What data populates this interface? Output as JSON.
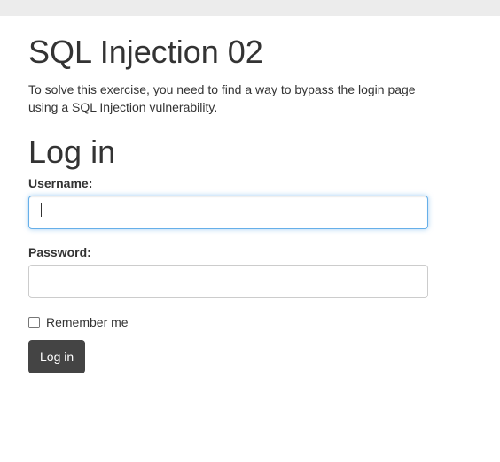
{
  "page": {
    "title": "SQL Injection 02",
    "description": "To solve this exercise, you need to find a way to bypass the login page using a SQL Injection vulnerability."
  },
  "login_form": {
    "heading": "Log in",
    "username": {
      "label": "Username:",
      "value": "",
      "focused": true
    },
    "password": {
      "label": "Password:",
      "value": ""
    },
    "remember_me": {
      "label": "Remember me",
      "checked": false
    },
    "submit_label": "Log in"
  },
  "colors": {
    "top_bar": "#ececec",
    "text": "#333333",
    "button_bg": "#444444",
    "button_text": "#ffffff",
    "focus_border": "#66afe9",
    "input_border": "#cccccc"
  }
}
